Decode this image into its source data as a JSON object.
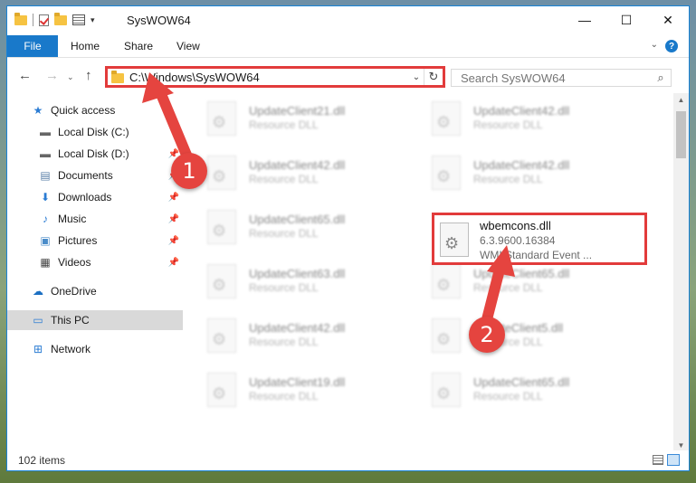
{
  "window": {
    "title": "SysWOW64",
    "controls": {
      "minimize": "—",
      "maximize": "☐",
      "close": "✕"
    }
  },
  "ribbon": {
    "tabs": [
      "File",
      "Home",
      "Share",
      "View"
    ],
    "help": "?"
  },
  "nav": {
    "address": "C:\\Windows\\SysWOW64",
    "search_placeholder": "Search SysWOW64"
  },
  "sidebar": {
    "items": [
      {
        "label": "Quick access",
        "icon": "star-icon",
        "pinned": false
      },
      {
        "label": "Local Disk (C:)",
        "icon": "drive-icon",
        "pinned": false
      },
      {
        "label": "Local Disk (D:)",
        "icon": "drive-icon",
        "pinned": true
      },
      {
        "label": "Documents",
        "icon": "documents-icon",
        "pinned": true
      },
      {
        "label": "Downloads",
        "icon": "download-icon",
        "pinned": true
      },
      {
        "label": "Music",
        "icon": "music-icon",
        "pinned": true
      },
      {
        "label": "Pictures",
        "icon": "pictures-icon",
        "pinned": true
      },
      {
        "label": "Videos",
        "icon": "videos-icon",
        "pinned": true
      },
      {
        "label": "OneDrive",
        "icon": "cloud-icon",
        "pinned": false
      },
      {
        "label": "This PC",
        "icon": "computer-icon",
        "pinned": false,
        "selected": true
      },
      {
        "label": "Network",
        "icon": "network-icon",
        "pinned": false
      }
    ]
  },
  "files": {
    "left": [
      {
        "name": "UpdateClient21.dll",
        "type": "Resource DLL"
      },
      {
        "name": "UpdateClient42.dll",
        "type": "Resource DLL"
      },
      {
        "name": "UpdateClient65.dll",
        "type": "Resource DLL"
      },
      {
        "name": "UpdateClient63.dll",
        "type": "Resource DLL"
      },
      {
        "name": "UpdateClient42.dll",
        "type": "Resource DLL"
      },
      {
        "name": "UpdateClient19.dll",
        "type": "Resource DLL"
      }
    ],
    "right": [
      {
        "name": "UpdateClient42.dll",
        "type": "Resource DLL"
      },
      {
        "name": "UpdateClient42.dll",
        "type": "Resource DLL"
      },
      {
        "name": "UpdateClient65.dll",
        "type": "Resource DLL"
      },
      {
        "name": "UpdateClient5.dll",
        "type": "Resource DLL"
      },
      {
        "name": "UpdateClient65.dll",
        "type": "Resource DLL"
      }
    ],
    "highlighted": {
      "name": "wbemcons.dll",
      "version": "6.3.9600.16384",
      "description": "WMI Standard Event ..."
    }
  },
  "status": {
    "item_count": "102 items"
  },
  "annotations": {
    "step1": "1",
    "step2": "2",
    "color": "#e23b3b"
  }
}
